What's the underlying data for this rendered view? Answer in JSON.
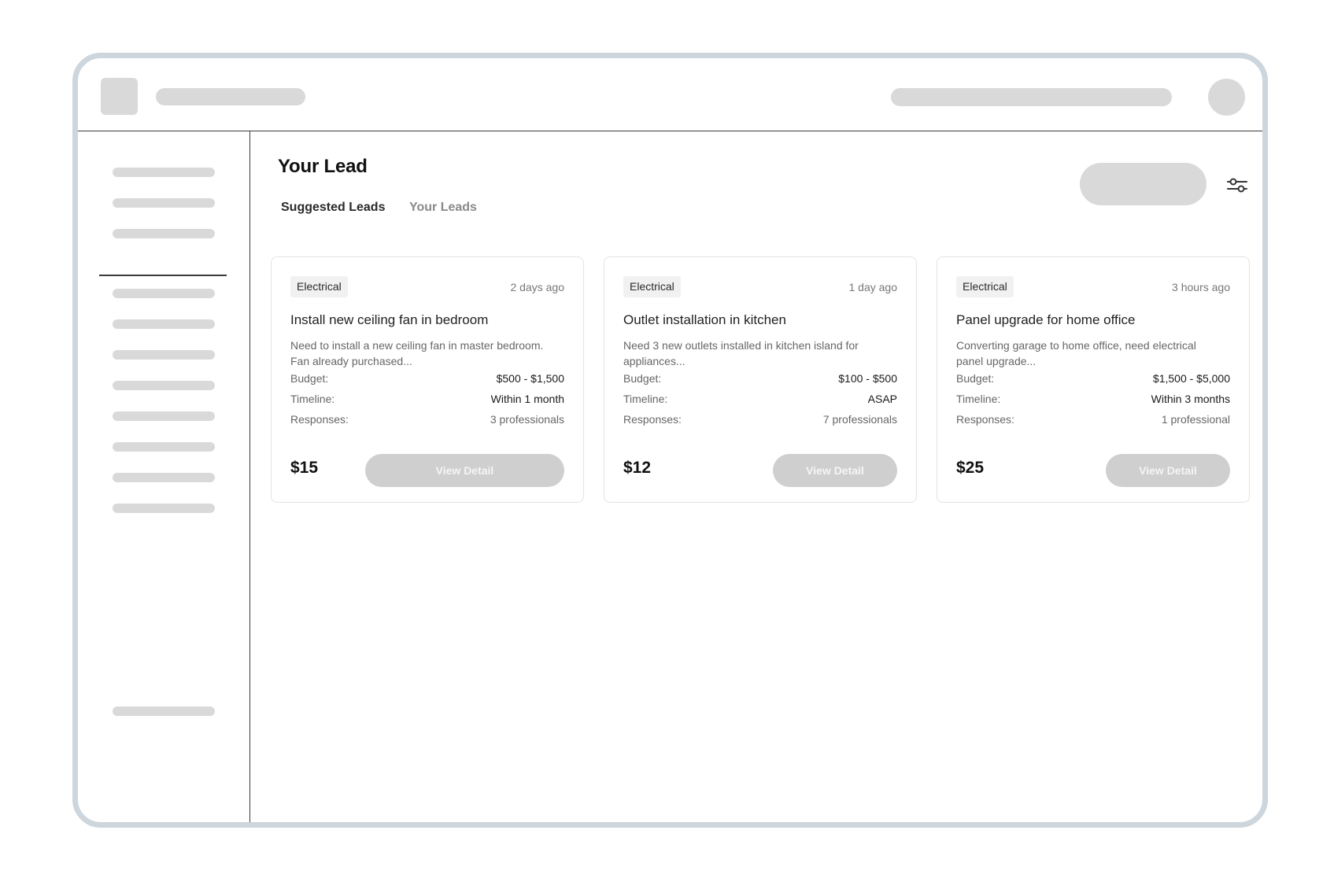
{
  "main": {
    "page_title": "Your Lead",
    "tabs": [
      {
        "label": "Suggested Leads",
        "active": true
      },
      {
        "label": "Your Leads",
        "active": false
      }
    ]
  },
  "cards": [
    {
      "tag": "Electrical",
      "time": "2 days ago",
      "title": "Install new ceiling fan in bedroom",
      "desc_line1": "Need to install a new ceiling fan in master bedroom.",
      "desc_line2": "Fan already purchased...",
      "budget_label": "Budget:",
      "budget": "$500 - $1,500",
      "timeline_label": "Timeline:",
      "timeline": "Within 1 month",
      "responses_label": "Responses:",
      "responses": "3 professionals",
      "price": "$15",
      "button": "View Detail"
    },
    {
      "tag": "Electrical",
      "time": "1 day ago",
      "title": "Outlet installation in kitchen",
      "desc_line1": "Need 3 new outlets installed in kitchen island for",
      "desc_line2": "appliances...",
      "budget_label": "Budget:",
      "budget": "$100 - $500",
      "timeline_label": "Timeline:",
      "timeline": "ASAP",
      "responses_label": "Responses:",
      "responses": "7 professionals",
      "price": "$12",
      "button": "View Detail"
    },
    {
      "tag": "Electrical",
      "time": "3 hours ago",
      "title": "Panel upgrade for home office",
      "desc_line1": "Converting garage to home office, need electrical",
      "desc_line2": "panel upgrade...",
      "budget_label": "Budget:",
      "budget": "$1,500 - $5,000",
      "timeline_label": "Timeline:",
      "timeline": "Within 3 months",
      "responses_label": "Responses:",
      "responses": "1 professional",
      "price": "$25",
      "button": "View Detail"
    }
  ],
  "icons": {
    "filter": "sliders-icon"
  }
}
